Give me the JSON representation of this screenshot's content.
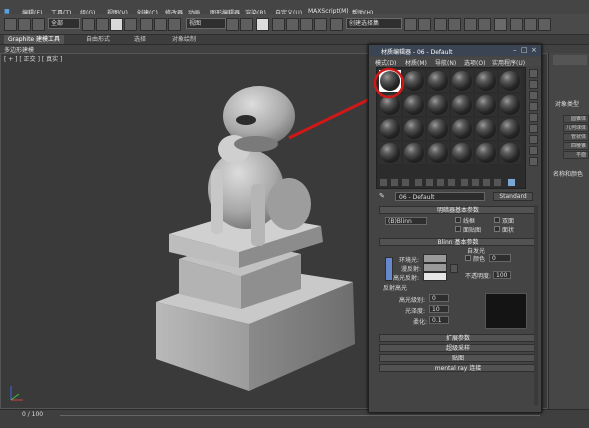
{
  "menu_items": [
    "编辑(E)",
    "工具(T)",
    "组(G)",
    "视图(V)",
    "创建(C)",
    "修改器",
    "动画",
    "图形编辑器",
    "渲染(R)",
    "自定义(U)",
    "MAXScript(M)",
    "帮助(H)"
  ],
  "toolbar": {
    "selection_filter": "全部",
    "view_dropdown": "视图",
    "named_selection": "创建选择集"
  },
  "ribbon_tabs": [
    "Graphite 建模工具",
    "自由形式",
    "选择",
    "对象绘制"
  ],
  "sub_label": "多边形建模",
  "viewport_label": "[ + ] [ 正交 ] [ 真实 ]",
  "material_editor": {
    "title": "材质编辑器 - 06 - Default",
    "menu": [
      "模式(D)",
      "材质(M)",
      "导航(N)",
      "选项(O)",
      "实用程序(U)"
    ],
    "material_name": "06 - Default",
    "material_type": "Standard",
    "shader_rollout": "明暗器基本参数",
    "shader_type": "(B)Blinn",
    "shader_options": [
      "线框",
      "双面",
      "面贴图",
      "面状"
    ],
    "blinn_rollout": "Blinn 基本参数",
    "self_illum_group": "自发光",
    "self_illum_color": "颜色",
    "self_illum_value": "0",
    "ambient": "环境光:",
    "diffuse": "漫反射:",
    "specular": "高光反射:",
    "opacity": "不透明度:",
    "opacity_value": "100",
    "highlight_group": "反射高光",
    "spec_level": "高光级别:",
    "spec_level_value": "0",
    "glossiness": "光泽度:",
    "glossiness_value": "10",
    "soften": "柔化:",
    "soften_value": "0.1",
    "extended_rollout": "扩展参数",
    "supersampling_rollout": "超级采样",
    "maps_rollout": "贴图",
    "mental_ray_rollout": "mental ray 连接"
  },
  "command_panel": {
    "heading": "对象类型",
    "items": [
      "圆锥体",
      "几何球体",
      "管状体",
      "四棱锥",
      "平面"
    ],
    "name_color": "名称和颜色"
  },
  "timeline": {
    "frame": "0 / 100"
  },
  "colors": {
    "annotation_arrow": "#d01818",
    "highlight_circle": "#d01818"
  }
}
